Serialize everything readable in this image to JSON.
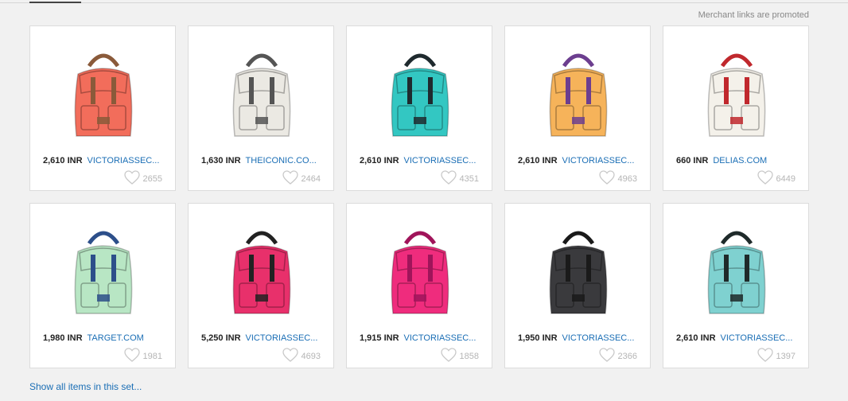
{
  "header": {
    "promo_text": "Merchant links are promoted"
  },
  "items": [
    {
      "price": "2,610 INR",
      "merchant": "VICTORIASSEC...",
      "likes": "2655",
      "image": "coral-backpack",
      "color": "#f26d5b",
      "accent": "#8a5a3a"
    },
    {
      "price": "1,630 INR",
      "merchant": "THEICONIC.CO...",
      "likes": "2464",
      "image": "white-studded-backpack",
      "color": "#ebe9e3",
      "accent": "#555555"
    },
    {
      "price": "2,610 INR",
      "merchant": "VICTORIASSEC...",
      "likes": "4351",
      "image": "turquoise-striped-backpack",
      "color": "#33c7c2",
      "accent": "#1f2a2e"
    },
    {
      "price": "2,610 INR",
      "merchant": "VICTORIASSEC...",
      "likes": "4963",
      "image": "palm-print-backpack",
      "color": "#f6b35a",
      "accent": "#6c3e8f"
    },
    {
      "price": "660 INR",
      "merchant": "DELIAS.COM",
      "likes": "6449",
      "image": "union-jack-backpack",
      "color": "#f4f1ea",
      "accent": "#c0282d"
    },
    {
      "price": "1,980 INR",
      "merchant": "TARGET.COM",
      "likes": "1981",
      "image": "bird-print-backpack",
      "color": "#b8e6c4",
      "accent": "#2d4f8a"
    },
    {
      "price": "5,250 INR",
      "merchant": "VICTORIASSEC...",
      "likes": "4693",
      "image": "pink-striped-backpack",
      "color": "#e8306b",
      "accent": "#222222"
    },
    {
      "price": "1,915 INR",
      "merchant": "VICTORIASSEC...",
      "likes": "1858",
      "image": "hot-pink-backpack",
      "color": "#ef2c7d",
      "accent": "#a0145a"
    },
    {
      "price": "1,950 INR",
      "merchant": "VICTORIASSEC...",
      "likes": "2366",
      "image": "black-backpack",
      "color": "#3a3a3d",
      "accent": "#1a1a1a"
    },
    {
      "price": "2,610 INR",
      "merchant": "VICTORIASSEC...",
      "likes": "1397",
      "image": "leopard-backpack",
      "color": "#7fd1d0",
      "accent": "#1f2a2a"
    }
  ],
  "footer": {
    "show_all_label": "Show all items in this set..."
  }
}
